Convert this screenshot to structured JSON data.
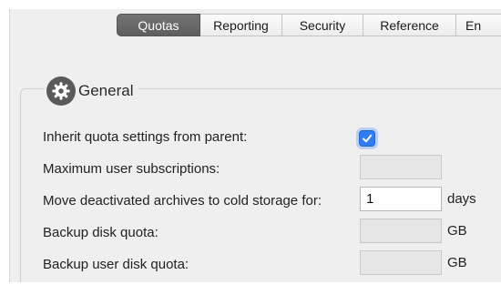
{
  "tabs": [
    {
      "label": "Quotas",
      "active": true
    },
    {
      "label": "Reporting",
      "active": false
    },
    {
      "label": "Security",
      "active": false
    },
    {
      "label": "Reference",
      "active": false
    },
    {
      "label": "En",
      "active": false
    }
  ],
  "general": {
    "title": "General",
    "icon": "gear-icon",
    "inherit_label": "Inherit quota settings from parent:",
    "inherit_checked": true,
    "max_subscriptions_label": "Maximum user subscriptions:",
    "max_subscriptions_value": "",
    "cold_storage_label": "Move deactivated archives to cold storage for:",
    "cold_storage_value": "1",
    "cold_storage_unit": "days",
    "backup_disk_label": "Backup disk quota:",
    "backup_disk_value": "",
    "backup_disk_unit": "GB",
    "backup_user_disk_label": "Backup user disk quota:",
    "backup_user_disk_value": "",
    "backup_user_disk_unit": "GB"
  },
  "colors": {
    "accent": "#2f7df6",
    "active_tab": "#666666",
    "panel_background": "#efefef"
  }
}
